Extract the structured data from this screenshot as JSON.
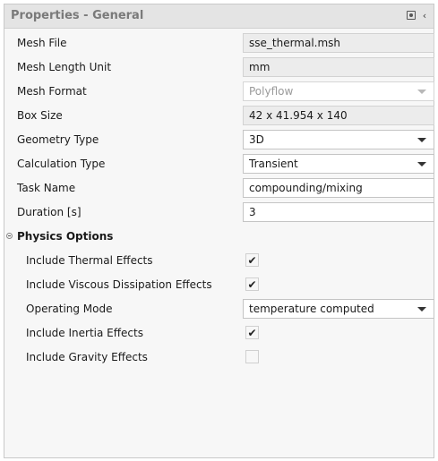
{
  "panel": {
    "title": "Properties - General",
    "icons": [
      "pin-icon",
      "collapse-arrow-icon"
    ]
  },
  "general": {
    "mesh_file": {
      "label": "Mesh File",
      "value": "sse_thermal.msh"
    },
    "mesh_length_unit": {
      "label": "Mesh Length Unit",
      "value": "mm"
    },
    "mesh_format": {
      "label": "Mesh Format",
      "value": "Polyflow"
    },
    "box_size": {
      "label": "Box Size",
      "value": "42 x 41.954 x 140"
    },
    "geometry_type": {
      "label": "Geometry Type",
      "value": "3D"
    },
    "calculation_type": {
      "label": "Calculation Type",
      "value": "Transient"
    },
    "task_name": {
      "label": "Task Name",
      "value": "compounding/mixing"
    },
    "duration": {
      "label": "Duration [s]",
      "value": "3"
    }
  },
  "physics": {
    "section_label": "Physics Options",
    "include_thermal": {
      "label": "Include Thermal Effects",
      "checked": true
    },
    "include_viscous": {
      "label": "Include Viscous Dissipation Effects",
      "checked": true
    },
    "operating_mode": {
      "label": "Operating Mode",
      "value": "temperature computed"
    },
    "include_inertia": {
      "label": "Include Inertia Effects",
      "checked": true
    },
    "include_gravity": {
      "label": "Include Gravity Effects",
      "checked": false
    }
  },
  "glyphs": {
    "check": "✔"
  }
}
